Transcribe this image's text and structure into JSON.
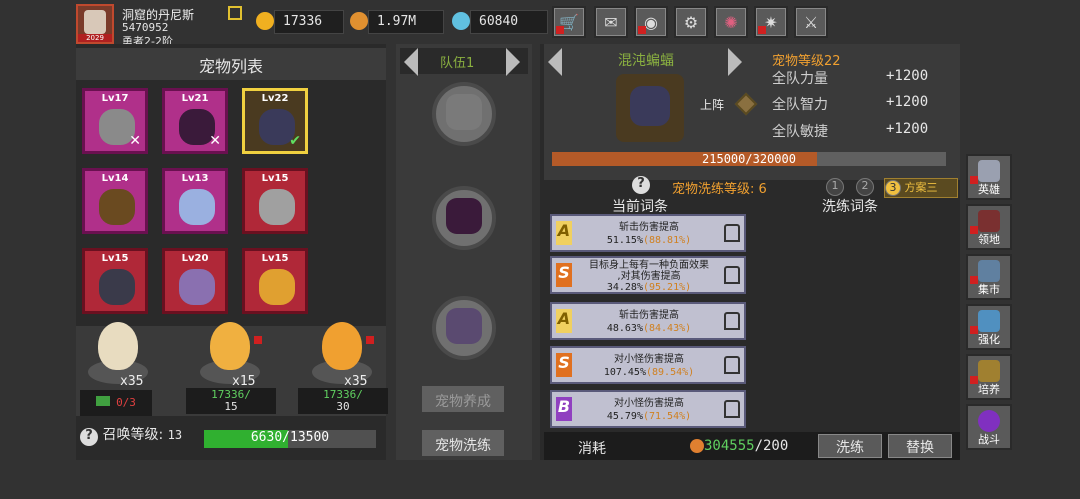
{
  "player": {
    "name": "洞窟的丹尼斯",
    "id": "5470952",
    "rank": "勇者2-2阶",
    "avatar_year": "2029"
  },
  "resources": [
    {
      "icon": "gold-drop-icon",
      "value": "17336"
    },
    {
      "icon": "coin-icon",
      "value": "1.97M"
    },
    {
      "icon": "gem-icon",
      "value": "60840"
    }
  ],
  "toolbar": [
    "shop-cart-icon",
    "mail-icon",
    "gamepad-icon",
    "gear-icon",
    "color-wheel-icon",
    "fireworks-icon",
    "crossed-swords-icon"
  ],
  "pet_list": {
    "title": "宠物列表",
    "pets": [
      {
        "level": "Lv17",
        "mark": "✕"
      },
      {
        "level": "Lv21",
        "mark": "✕"
      },
      {
        "level": "Lv22",
        "mark": "✔"
      },
      {
        "level": "Lv14",
        "mark": ""
      },
      {
        "level": "Lv13",
        "mark": ""
      },
      {
        "level": "Lv15",
        "mark": ""
      },
      {
        "level": "Lv15",
        "mark": ""
      },
      {
        "level": "Lv20",
        "mark": ""
      },
      {
        "level": "Lv15",
        "mark": ""
      }
    ]
  },
  "eggs": [
    {
      "count": "x35",
      "cost_top": "0/3",
      "cost_bottom": ""
    },
    {
      "count": "x15",
      "cost_top": "17336/",
      "cost_bottom": "15"
    },
    {
      "count": "x35",
      "cost_top": "17336/",
      "cost_bottom": "30"
    }
  ],
  "summon": {
    "label": "召唤等级:",
    "level": "13",
    "progress_text": "6630/13500",
    "progress": 0.491
  },
  "team": {
    "label": "队伍1",
    "btn_train": "宠物养成",
    "btn_wash": "宠物洗练"
  },
  "detail": {
    "pet_name": "混沌蝙蝠",
    "pet_level": "宠物等级22",
    "up_label": "上阵",
    "stats": [
      {
        "name": "全队力量",
        "value": "+1200"
      },
      {
        "name": "全队智力",
        "value": "+1200"
      },
      {
        "name": "全队敏捷",
        "value": "+1200"
      }
    ],
    "exp_text": "215000/320000",
    "exp": 0.672
  },
  "wash": {
    "label": "宠物洗练等级: 6",
    "plans": [
      "1",
      "2",
      "3"
    ],
    "plan_selected": "方案三",
    "col_current": "当前词条",
    "col_wash": "洗练词条"
  },
  "affixes": [
    {
      "grade": "A",
      "l1": "斩击伤害提高",
      "base": "51.15%",
      "max": "(88.81%)"
    },
    {
      "grade": "S",
      "l1": "目标身上每有一种负面效果",
      "l1b": ",对其伤害提高",
      "base": "34.28%",
      "max": "(95.21%)"
    },
    {
      "grade": "A",
      "l1": "斩击伤害提高",
      "base": "48.63%",
      "max": "(84.43%)"
    },
    {
      "grade": "S",
      "l1": "对小怪伤害提高",
      "base": "107.45%",
      "max": "(89.54%)"
    },
    {
      "grade": "B",
      "l1": "对小怪伤害提高",
      "base": "45.79%",
      "max": "(71.54%)"
    }
  ],
  "bottom": {
    "cost_label": "消耗",
    "coins_have": "304555",
    "coins_need": "/200",
    "btn_wash": "洗练",
    "btn_replace": "替换"
  },
  "sidenav": [
    {
      "label": "英雄",
      "icon": "helmet-icon"
    },
    {
      "label": "领地",
      "icon": "castle-icon"
    },
    {
      "label": "集市",
      "icon": "market-icon"
    },
    {
      "label": "强化",
      "icon": "enhance-icon"
    },
    {
      "label": "培养",
      "icon": "trophy-icon"
    },
    {
      "label": "战斗",
      "icon": "portal-icon"
    }
  ],
  "colors": {
    "accent_green": "#8ab040",
    "accent_orange": "#f0a030",
    "exp_bar": "#b45a28",
    "summon_bar": "#30b030"
  }
}
